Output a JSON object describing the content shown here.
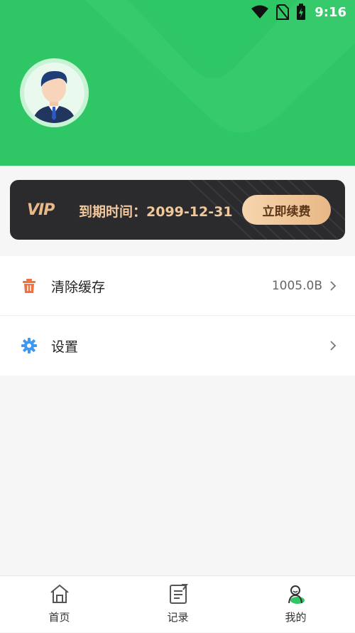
{
  "status_bar": {
    "time": "9:16",
    "icons": [
      "wifi-icon",
      "no-sim-icon",
      "battery-charging-icon"
    ]
  },
  "header": {
    "background_color": "#2fc765",
    "avatar": "avatar-businessman"
  },
  "vip_card": {
    "logo": "VIP",
    "expire_text": "到期时间：2099-12-31",
    "renew_label": "立即续费"
  },
  "menu": {
    "items": [
      {
        "icon": "trash-icon",
        "label": "清除缓存",
        "value": "1005.0B"
      },
      {
        "icon": "gear-icon",
        "label": "设置",
        "value": ""
      }
    ]
  },
  "tabbar": {
    "active_index": 2,
    "active_color": "#2fc765",
    "tabs": [
      {
        "icon": "home-icon",
        "label": "首页"
      },
      {
        "icon": "record-icon",
        "label": "记录"
      },
      {
        "icon": "profile-icon",
        "label": "我的"
      }
    ]
  }
}
